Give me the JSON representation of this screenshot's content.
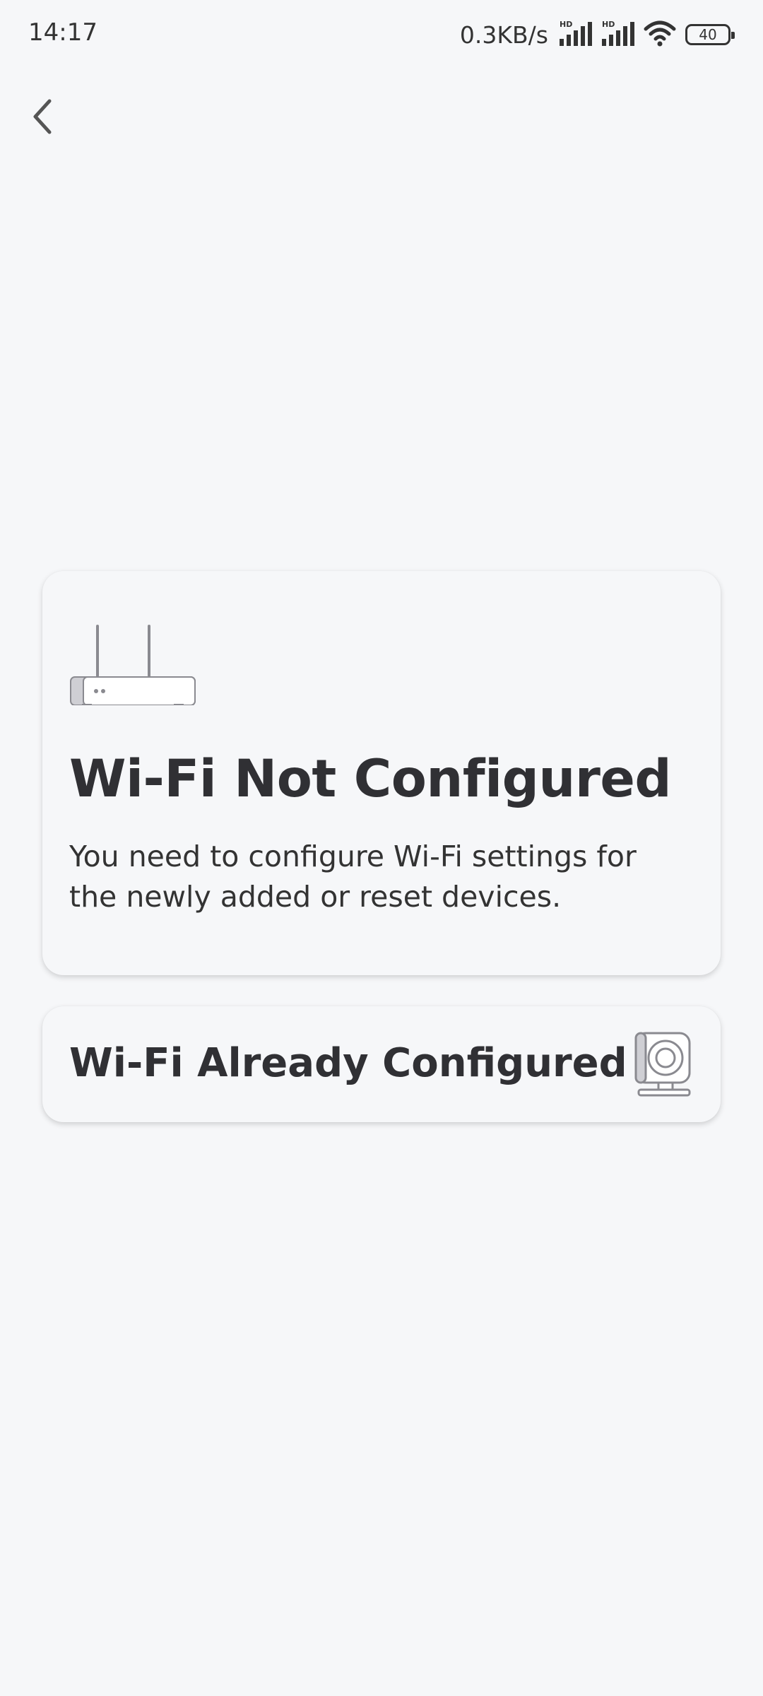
{
  "status_bar": {
    "time": "14:17",
    "net_speed": "0.3KB/s",
    "signal1_label": "HD",
    "signal2_label": "HD",
    "battery": "40",
    "icons": [
      "signal-icon",
      "signal-icon",
      "wifi-icon",
      "battery-icon"
    ]
  },
  "nav": {
    "back_icon": "chevron-left-icon"
  },
  "cards": {
    "not_configured": {
      "icon": "router-icon",
      "title": "Wi-Fi Not Configured",
      "description": "You need to configure Wi-Fi settings for the newly added or reset devices."
    },
    "configured": {
      "title": "Wi-Fi Already Configured",
      "icon": "camera-icon"
    }
  },
  "colors": {
    "background": "#f6f7f9",
    "text": "#303034",
    "icon_gray": "#8a8a90"
  }
}
